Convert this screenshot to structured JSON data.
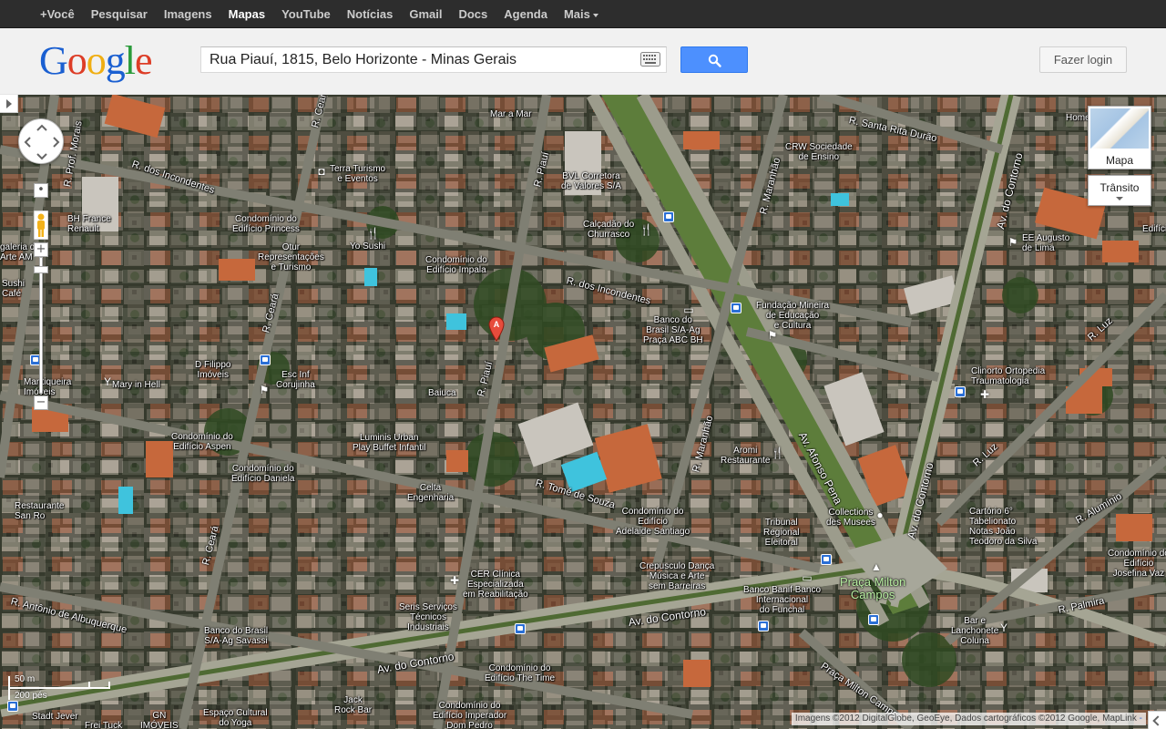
{
  "topnav": {
    "items": [
      {
        "label": "+Você"
      },
      {
        "label": "Pesquisar"
      },
      {
        "label": "Imagens"
      },
      {
        "label": "Mapas"
      },
      {
        "label": "YouTube"
      },
      {
        "label": "Notícias"
      },
      {
        "label": "Gmail"
      },
      {
        "label": "Docs"
      },
      {
        "label": "Agenda"
      },
      {
        "label": "Mais"
      }
    ],
    "active": "Mapas"
  },
  "header": {
    "logo_text": "Google",
    "search_value": "Rua Piauí, 1815, Belo Horizonte - Minas Gerais",
    "login_label": "Fazer login"
  },
  "map_controls": {
    "map_type_label": "Mapa",
    "traffic_label": "Trânsito",
    "scale_metric": "50 m",
    "scale_imperial": "200 pés",
    "attribution": "Imagens ©2012 DigitalGlobe, GeoEye, Dados cartográficos ©2012 Google, MapLink",
    "attribution_link": "-"
  },
  "streets": [
    {
      "text": "R. dos Incondentes"
    },
    {
      "text": "R. dos Incondentes"
    },
    {
      "text": "R. Santa Rita Durão"
    },
    {
      "text": "R. Ceará"
    },
    {
      "text": "R. Ceará"
    },
    {
      "text": "R. Ceará"
    },
    {
      "text": "R. Piauí"
    },
    {
      "text": "R. Piauí"
    },
    {
      "text": "R. Maranhão"
    },
    {
      "text": "R. Maranhão"
    },
    {
      "text": "Av. Afonso Pena"
    },
    {
      "text": "Av. do Contorno"
    },
    {
      "text": "Av. do Contorno"
    },
    {
      "text": "Av. do Contorno"
    },
    {
      "text": "Av. do Contorno"
    },
    {
      "text": "R. Tomé de Souza"
    },
    {
      "text": "R. Antônio de Albuquerque"
    },
    {
      "text": "R. Prof. Morais"
    },
    {
      "text": "R. Luz"
    },
    {
      "text": "R. Luz"
    },
    {
      "text": "R. Alumínio"
    },
    {
      "text": "R. Palmira"
    },
    {
      "text": "Praça Milton Campos"
    }
  ],
  "places": [
    {
      "text": "Mar a Mar"
    },
    {
      "text": "Terra Turismo\ne Eventos"
    },
    {
      "text": "BVL Corretora\nde Valores S/A"
    },
    {
      "text": "CRW Sociedade\nde Ensino"
    },
    {
      "text": "BH France\nRenault"
    },
    {
      "text": "Condomínio do\nEdifício Princess"
    },
    {
      "text": "Calçadão do\nChurrasco"
    },
    {
      "text": "Yo Sushi"
    },
    {
      "text": "Otur\nRepresentações\ne Turismo"
    },
    {
      "text": "Condomínio do\nEdifício Impala"
    },
    {
      "text": "EE Augusto\nde Lima"
    },
    {
      "text": "Fundação Mineira\nde Educação\ne Cultura"
    },
    {
      "text": "Banco do\nBrasil S/A-Ag\nPraça ABC BH"
    },
    {
      "text": "D Filippo\nImóveis"
    },
    {
      "text": "Esc Inf\nCorujinha"
    },
    {
      "text": "Mary in Hell"
    },
    {
      "text": "Mantiqueira\nImóveis"
    },
    {
      "text": "Baiuca"
    },
    {
      "text": "Clinorto Ortopedia\nTraumatologia"
    },
    {
      "text": "Condomínio do\nEdifício Aspen"
    },
    {
      "text": "Luminis Urban\nPlay Buffet Infantil"
    },
    {
      "text": "Aromi\nRestaurante"
    },
    {
      "text": "Condomínio do\nEdifício Daniela"
    },
    {
      "text": "Celta\nEngenharia"
    },
    {
      "text": "Restaurante\nSan Ro"
    },
    {
      "text": "Condomínio do\nEdifício\nAdelaide Santiago"
    },
    {
      "text": "Collections\ndes Musees"
    },
    {
      "text": "Tribunal\nRegional\nEleitoral"
    },
    {
      "text": "Cartório 6°\nTabelionato\nNotas João\nTeodoro da Silva"
    },
    {
      "text": "Condomínio do\nEdifício\nJosefina Vaz"
    },
    {
      "text": "Crepusculo Dança\nMúsica e Arte\nsem Barreiras"
    },
    {
      "text": "CER Clínica\nEspecializada\nem Reabilitação"
    },
    {
      "text": "Banco Banif Banco\nInternacional\ndo Funchal"
    },
    {
      "text": "Seris Serviços\nTécnicos\nIndustriais"
    },
    {
      "text": "Banco do Brasil\nS/A-Ag Savassi"
    },
    {
      "text": "Bar e\nLanchonete\nColuna"
    },
    {
      "text": "Condomínio do\nEdifício The Time"
    },
    {
      "text": "Jack\nRock Bar"
    },
    {
      "text": "Condomínio do\nEdifício Imperador\nDom Pedro"
    },
    {
      "text": "Stadt Jever"
    },
    {
      "text": "Frei Tuck"
    },
    {
      "text": "GN\nIMÓVEIS"
    },
    {
      "text": "Espaço Cultural\ndo Yoga"
    },
    {
      "text": "Sushi\nCafé"
    },
    {
      "text": "galeria do\nArte AM"
    },
    {
      "text": "Home"
    },
    {
      "text": "Edifício"
    }
  ]
}
